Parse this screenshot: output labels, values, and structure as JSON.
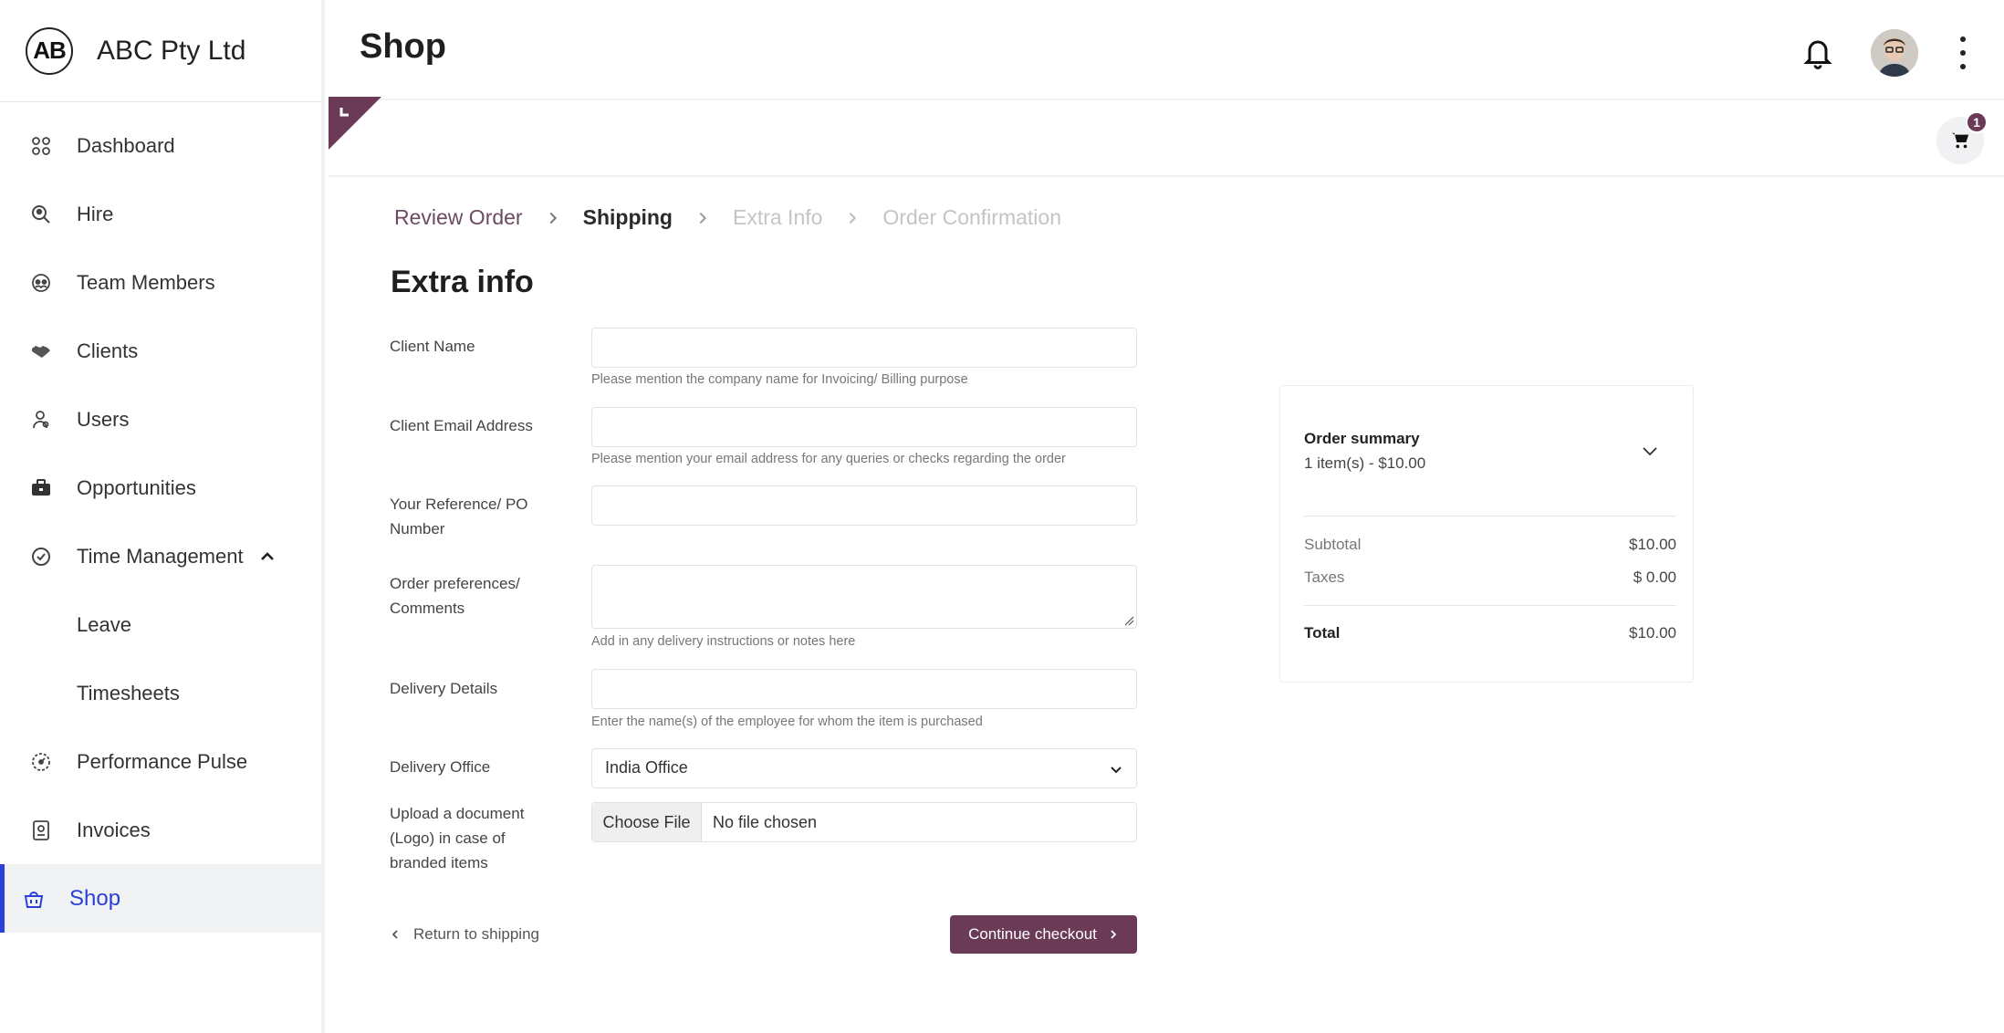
{
  "brand": {
    "logo_text": "AB",
    "name": "ABC Pty Ltd"
  },
  "sidebar": {
    "items": [
      {
        "label": "Dashboard",
        "icon": "dashboard-icon"
      },
      {
        "label": "Hire",
        "icon": "hire-search-icon"
      },
      {
        "label": "Team Members",
        "icon": "team-icon"
      },
      {
        "label": "Clients",
        "icon": "handshake-icon"
      },
      {
        "label": "Users",
        "icon": "users-icon"
      },
      {
        "label": "Opportunities",
        "icon": "briefcase-icon"
      },
      {
        "label": "Time Management",
        "icon": "clock-check-icon",
        "expanded": true
      },
      {
        "label": "Leave",
        "sub": true
      },
      {
        "label": "Timesheets",
        "sub": true
      },
      {
        "label": "Performance Pulse",
        "icon": "gauge-icon"
      },
      {
        "label": "Invoices",
        "icon": "invoice-icon"
      },
      {
        "label": "Shop",
        "icon": "shop-basket-icon",
        "active": true
      }
    ]
  },
  "header": {
    "title": "Shop",
    "cart_count": "1"
  },
  "breadcrumb": {
    "steps": [
      "Review Order",
      "Shipping",
      "Extra Info",
      "Order Confirmation"
    ]
  },
  "form": {
    "title": "Extra info",
    "client_name": {
      "label": "Client Name",
      "value": "",
      "help": "Please mention the company name for Invoicing/ Billing purpose"
    },
    "client_email": {
      "label": "Client Email Address",
      "value": "",
      "help": "Please mention your email address for any queries or checks regarding the order"
    },
    "reference": {
      "label_line1": "Your Reference/ PO",
      "label_line2": "Number",
      "value": ""
    },
    "preferences": {
      "label_line1": "Order preferences/",
      "label_line2": "Comments",
      "value": "",
      "help": "Add in any delivery instructions or notes here"
    },
    "delivery_details": {
      "label": "Delivery Details",
      "value": "",
      "help": "Enter the name(s) of the employee for whom the item is purchased"
    },
    "delivery_office": {
      "label": "Delivery Office",
      "selected": "India Office"
    },
    "upload": {
      "label_line1": "Upload a document",
      "label_line2": "(Logo) in case of",
      "label_line3": "branded items",
      "button": "Choose File",
      "status": "No file chosen"
    },
    "back_label": "Return to shipping",
    "continue_label": "Continue checkout"
  },
  "summary": {
    "title": "Order summary",
    "items": "1 item(s) - $10.00",
    "subtotal_label": "Subtotal",
    "subtotal": "$10.00",
    "taxes_label": "Taxes",
    "taxes": "$ 0.00",
    "total_label": "Total",
    "total": "$10.00"
  },
  "colors": {
    "accent": "#6b3a57",
    "active_nav": "#2b40d8"
  }
}
